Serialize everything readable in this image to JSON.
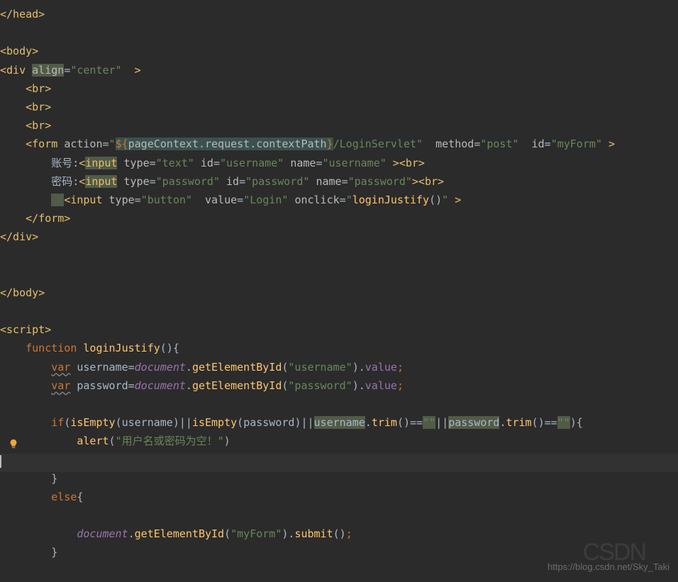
{
  "watermark": "https://blog.csdn.net/Sky_Taki",
  "code": {
    "l1": "</head>",
    "l2": "",
    "l3": "<body>",
    "div_open": "<div ",
    "align": "align",
    "center": "\"center\"",
    "close_gt": "  >",
    "br": "<br>",
    "form": "<form",
    "action": "action",
    "action_val_pre": "\"",
    "el_open": "${",
    "el_expr": "pageContext.request.contextPath",
    "el_close": "}",
    "action_val_post": "/LoginServlet\"",
    "method": "method",
    "post": "\"post\"",
    "id": "id",
    "myform": "\"myForm\"",
    "label_user": "账号:",
    "label_pass": "密码:",
    "input": "input",
    "type": "type",
    "text_t": "\"text\"",
    "password_t": "\"password\"",
    "button_t": "\"button\"",
    "id_user": "\"username\"",
    "id_pass": "\"password\"",
    "name": "name",
    "name_user": "\"username\"",
    "name_pass": "\"password\"",
    "value": "value",
    "login_v": "\"Login\"",
    "onclick": "onclick",
    "onclick_v_pre": "\"",
    "loginJustify": "loginJustify",
    "onclick_v_post": "\"",
    "form_close": "</form>",
    "div_close": "</div>",
    "body_close": "</body>",
    "script_open": "<script>",
    "fn_kw": "function",
    "fn_name": "loginJustify",
    "var_kw": "var",
    "username_var": "username",
    "password_var": "password",
    "document": "document",
    "getById": "getElementById",
    "username_s": "\"username\"",
    "password_s": "\"password\"",
    "value_prop": "value",
    "if_kw": "if",
    "isEmpty": "isEmpty",
    "trim": "trim",
    "empty_s": "\"\"",
    "alert": "alert",
    "alert_msg": "\"用户名或密码为空！\"",
    "else_kw": "else",
    "myform_s": "\"myForm\"",
    "submit": "submit"
  }
}
